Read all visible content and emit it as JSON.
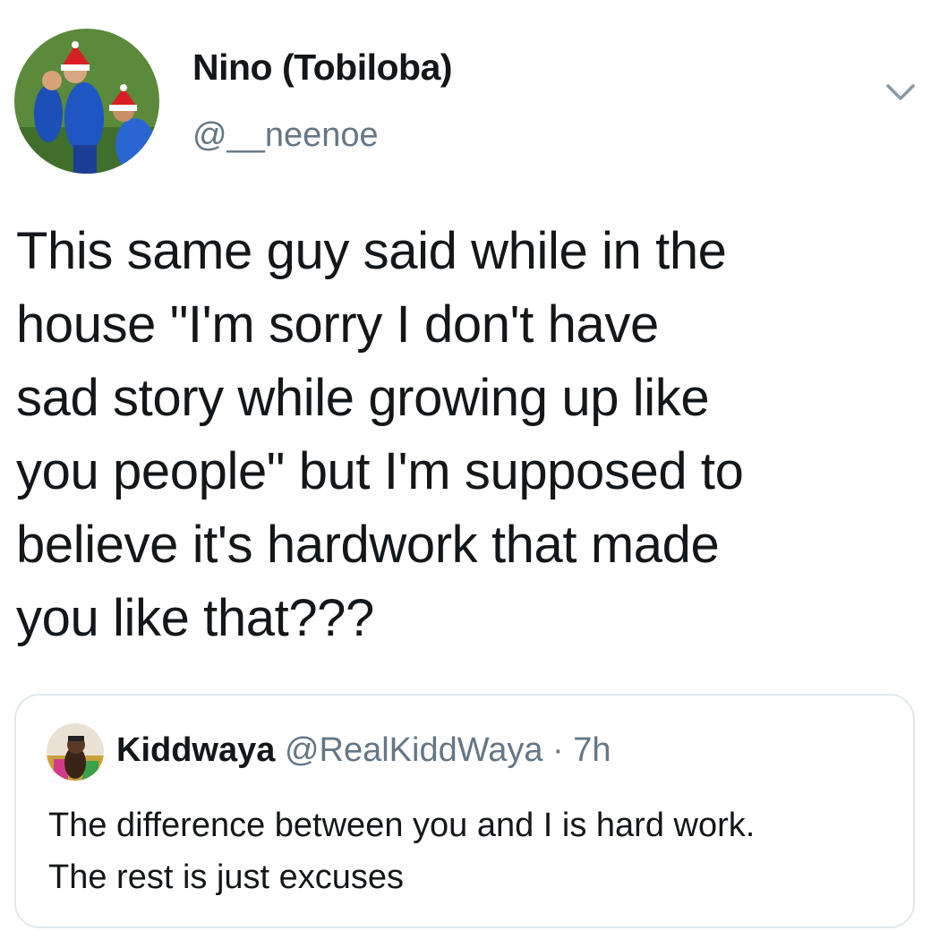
{
  "tweet": {
    "author": {
      "display_name": "Nino (Tobiloba)",
      "handle": "@__neenoe",
      "avatar_icon": "profile-avatar"
    },
    "menu_icon": "chevron-down-icon",
    "text": "This same guy said while in the\nhouse \"I'm sorry I don't have\nsad story while growing up like\nyou people\" but I'm supposed to\nbelieve it's hardwork that made\nyou like that???"
  },
  "quoted_tweet": {
    "author": {
      "display_name": "Kiddwaya",
      "handle": "@RealKiddWaya",
      "avatar_icon": "profile-avatar"
    },
    "separator": "·",
    "timestamp": "7h",
    "text": "The difference between you and I is hard work.\nThe rest is just excuses"
  },
  "colors": {
    "text_primary": "#14171a",
    "text_secondary": "#657786",
    "border": "#e1e8ed"
  }
}
